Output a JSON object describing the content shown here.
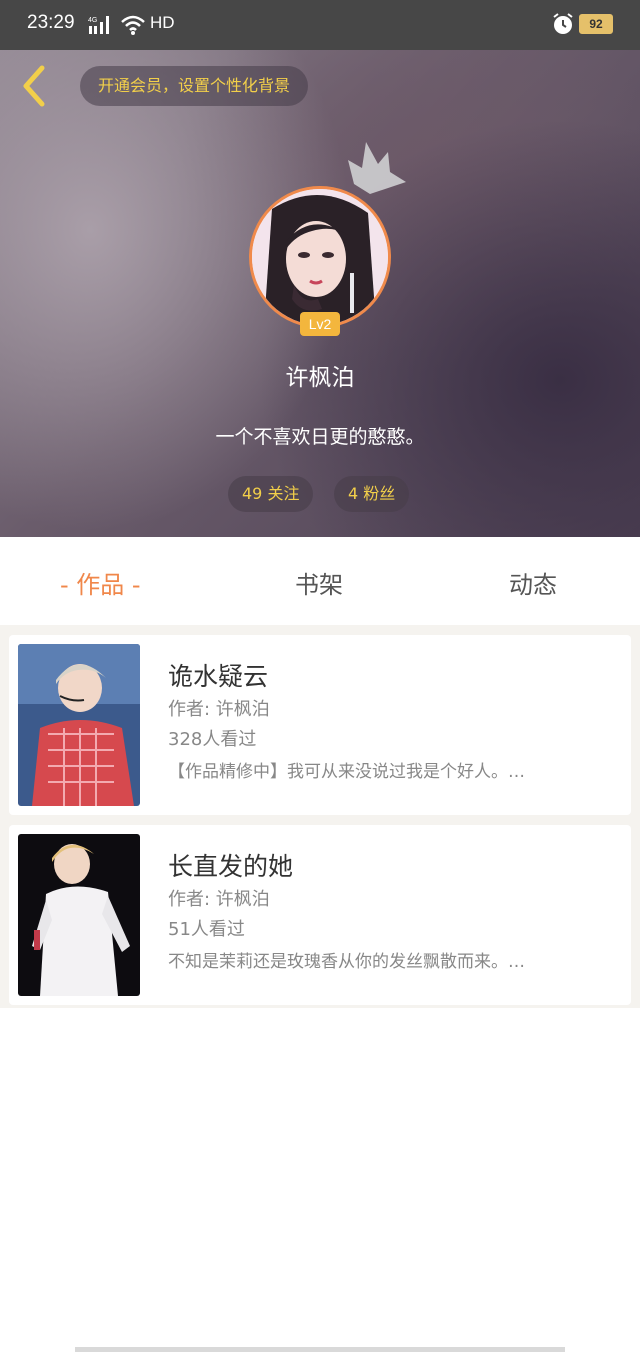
{
  "status_bar": {
    "time": "23:29",
    "network": "HD",
    "battery": "92"
  },
  "header": {
    "vip_prompt": "开通会员，设置个性化背景",
    "level": "Lv2",
    "username": "许枫泊",
    "bio": "一个不喜欢日更的憨憨。",
    "follow_label": "49 关注",
    "fans_label": "4 粉丝",
    "accent_color": "#f2cf4a"
  },
  "tabs": [
    {
      "label": "- 作品 -",
      "active": true
    },
    {
      "label": "书架",
      "active": false
    },
    {
      "label": "动态",
      "active": false
    }
  ],
  "works": [
    {
      "title": "诡水疑云",
      "author": "作者: 许枫泊",
      "views": "328人看过",
      "description": "【作品精修中】我可从来没说过我是个好人。…"
    },
    {
      "title": "长直发的她",
      "author": "作者: 许枫泊",
      "views": "51人看过",
      "description": "不知是茉莉还是玫瑰香从你的发丝飘散而来。…"
    }
  ],
  "colors": {
    "active_tab": "#f0874a",
    "avatar_ring": "#f08a4b",
    "level_badge": "#f3b63d"
  }
}
